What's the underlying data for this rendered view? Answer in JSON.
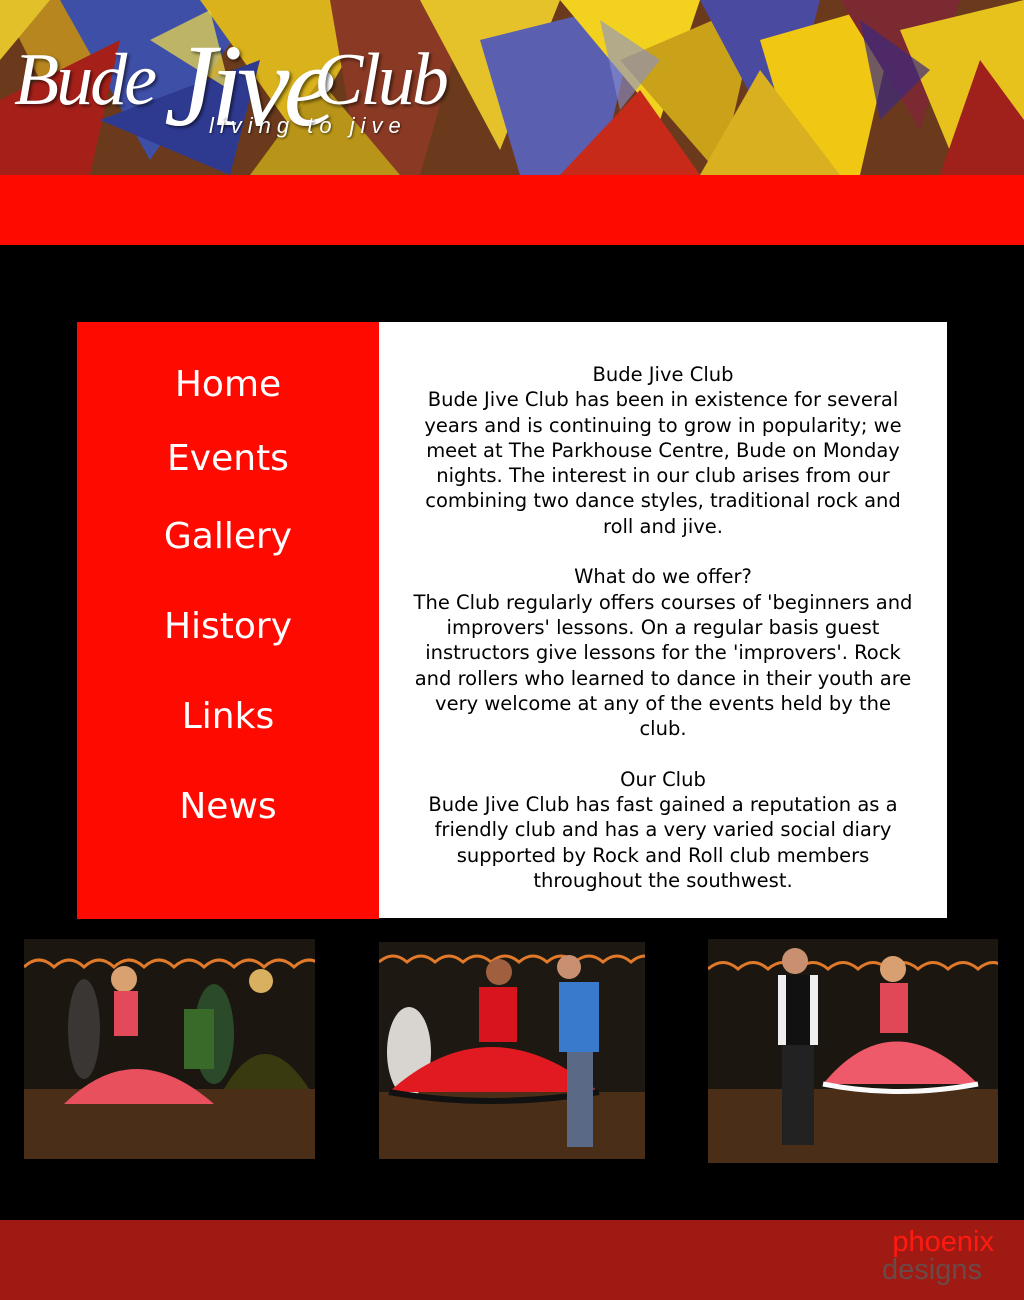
{
  "site": {
    "logo_words": [
      "Bude",
      "Jive",
      "Club"
    ],
    "tagline": "living to jive"
  },
  "nav": {
    "items": [
      {
        "label": "Home"
      },
      {
        "label": "Events"
      },
      {
        "label": "Gallery"
      },
      {
        "label": "History"
      },
      {
        "label": "Links"
      },
      {
        "label": "News"
      }
    ]
  },
  "content": {
    "sections": [
      {
        "heading": "Bude Jive Club",
        "body": "Bude Jive Club has been in existence for several years and is continuing to grow in popularity; we meet at The Parkhouse Centre, Bude on Monday nights. The interest in our club arises from our combining two dance styles, traditional rock and roll and jive."
      },
      {
        "heading": "What do we offer?",
        "body": "The Club regularly offers courses of 'beginners and improvers' lessons. On a regular basis guest instructors give lessons for the 'improvers'. Rock and rollers who learned to dance in their youth are very welcome at any of the events held by the club."
      },
      {
        "heading": "Our Club",
        "body": "Bude Jive Club has fast gained a reputation as a friendly club and has a very varied social diary supported by Rock and Roll club members throughout the southwest."
      }
    ]
  },
  "footer": {
    "brand_line1": "phoenix",
    "brand_line2": "designs"
  },
  "colors": {
    "accent_red": "#ff0a00",
    "footer_red": "#a01a14",
    "background": "#000000"
  }
}
